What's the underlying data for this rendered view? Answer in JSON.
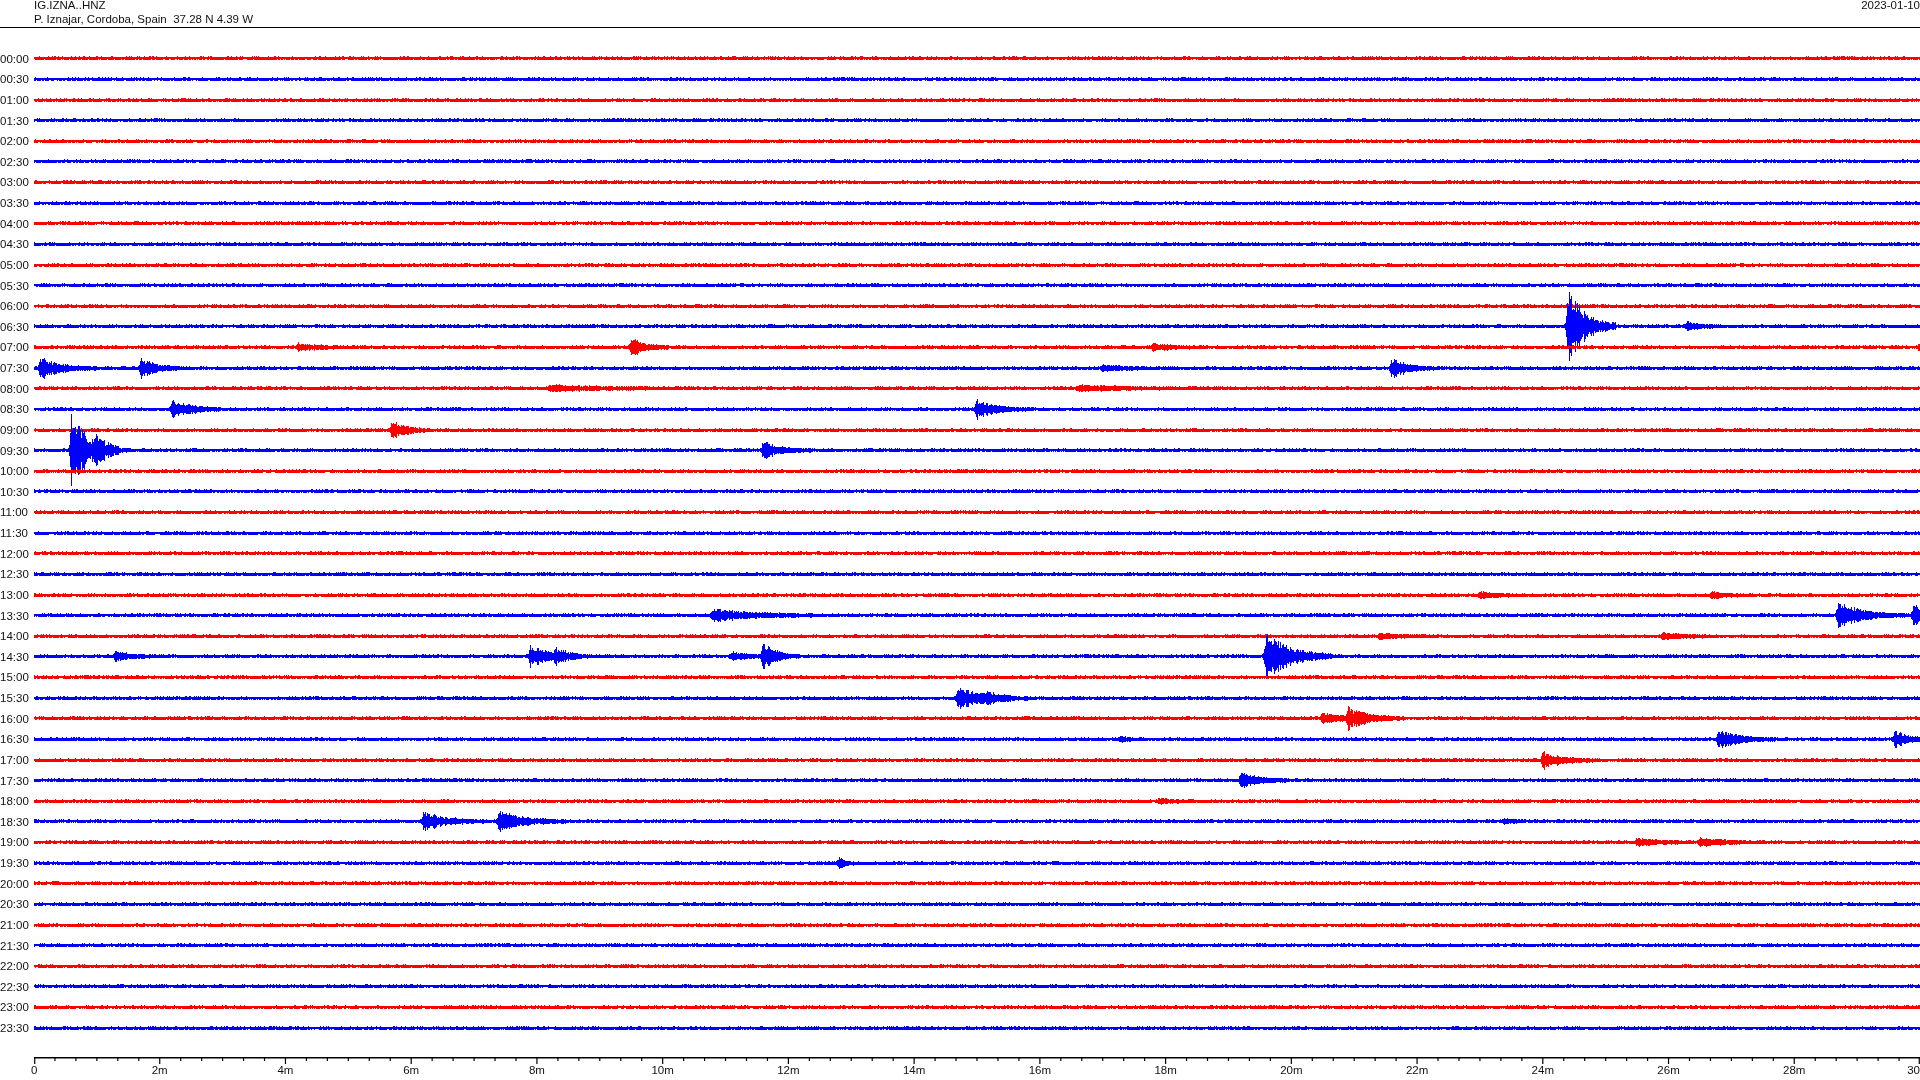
{
  "header": {
    "station": "IG.IZNA..HNZ",
    "location": "P. Iznajar, Cordoba, Spain  37.28 N 4.39 W",
    "date": "2023-01-10"
  },
  "rows": [
    {
      "time": "00:00",
      "color": "#ff0000"
    },
    {
      "time": "00:30",
      "color": "#0000ff"
    },
    {
      "time": "01:00",
      "color": "#ff0000"
    },
    {
      "time": "01:30",
      "color": "#0000ff"
    },
    {
      "time": "02:00",
      "color": "#ff0000"
    },
    {
      "time": "02:30",
      "color": "#0000ff"
    },
    {
      "time": "03:00",
      "color": "#ff0000"
    },
    {
      "time": "03:30",
      "color": "#0000ff"
    },
    {
      "time": "04:00",
      "color": "#ff0000"
    },
    {
      "time": "04:30",
      "color": "#0000ff"
    },
    {
      "time": "05:00",
      "color": "#ff0000"
    },
    {
      "time": "05:30",
      "color": "#0000ff"
    },
    {
      "time": "06:00",
      "color": "#ff0000"
    },
    {
      "time": "06:30",
      "color": "#0000ff"
    },
    {
      "time": "07:00",
      "color": "#ff0000"
    },
    {
      "time": "07:30",
      "color": "#0000ff"
    },
    {
      "time": "08:00",
      "color": "#ff0000"
    },
    {
      "time": "08:30",
      "color": "#0000ff"
    },
    {
      "time": "09:00",
      "color": "#ff0000"
    },
    {
      "time": "09:30",
      "color": "#0000ff"
    },
    {
      "time": "10:00",
      "color": "#ff0000"
    },
    {
      "time": "10:30",
      "color": "#0000ff"
    },
    {
      "time": "11:00",
      "color": "#ff0000"
    },
    {
      "time": "11:30",
      "color": "#0000ff"
    },
    {
      "time": "12:00",
      "color": "#ff0000"
    },
    {
      "time": "12:30",
      "color": "#0000ff"
    },
    {
      "time": "13:00",
      "color": "#ff0000"
    },
    {
      "time": "13:30",
      "color": "#0000ff"
    },
    {
      "time": "14:00",
      "color": "#ff0000"
    },
    {
      "time": "14:30",
      "color": "#0000ff"
    },
    {
      "time": "15:00",
      "color": "#ff0000"
    },
    {
      "time": "15:30",
      "color": "#0000ff"
    },
    {
      "time": "16:00",
      "color": "#ff0000"
    },
    {
      "time": "16:30",
      "color": "#0000ff"
    },
    {
      "time": "17:00",
      "color": "#ff0000"
    },
    {
      "time": "17:30",
      "color": "#0000ff"
    },
    {
      "time": "18:00",
      "color": "#ff0000"
    },
    {
      "time": "18:30",
      "color": "#0000ff"
    },
    {
      "time": "19:00",
      "color": "#ff0000"
    },
    {
      "time": "19:30",
      "color": "#0000ff"
    },
    {
      "time": "20:00",
      "color": "#ff0000"
    },
    {
      "time": "20:30",
      "color": "#0000ff"
    },
    {
      "time": "21:00",
      "color": "#ff0000"
    },
    {
      "time": "21:30",
      "color": "#0000ff"
    },
    {
      "time": "22:00",
      "color": "#ff0000"
    },
    {
      "time": "22:30",
      "color": "#0000ff"
    },
    {
      "time": "23:00",
      "color": "#ff0000"
    },
    {
      "time": "23:30",
      "color": "#0000ff"
    }
  ],
  "x_axis": {
    "labels": [
      "0",
      "2m",
      "4m",
      "6m",
      "8m",
      "10m",
      "12m",
      "14m",
      "16m",
      "18m",
      "20m",
      "22m",
      "24m",
      "26m",
      "28m",
      "30"
    ]
  }
}
